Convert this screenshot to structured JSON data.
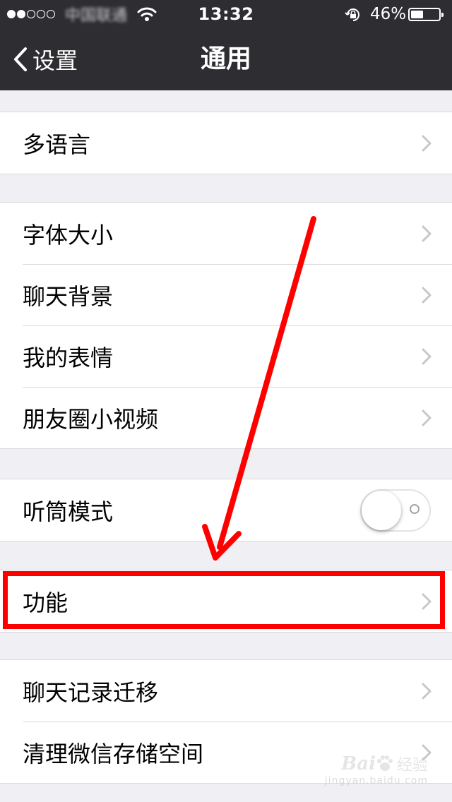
{
  "status_bar": {
    "carrier": "中国联通",
    "time": "13:32",
    "battery_percent": "46%",
    "battery_level": 0.46,
    "icons": [
      "signal-dots-icon",
      "wifi-icon",
      "rotation-lock-icon",
      "battery-icon"
    ]
  },
  "nav": {
    "back_label": "设置",
    "title": "通用"
  },
  "groups": [
    {
      "items": [
        {
          "label": "多语言",
          "accessory": "chevron"
        }
      ]
    },
    {
      "items": [
        {
          "label": "字体大小",
          "accessory": "chevron"
        },
        {
          "label": "聊天背景",
          "accessory": "chevron"
        },
        {
          "label": "我的表情",
          "accessory": "chevron"
        },
        {
          "label": "朋友圈小视频",
          "accessory": "chevron"
        }
      ]
    },
    {
      "items": [
        {
          "label": "听筒模式",
          "accessory": "toggle",
          "toggle_on": false
        }
      ]
    },
    {
      "items": [
        {
          "label": "功能",
          "accessory": "chevron",
          "highlighted": true
        }
      ]
    },
    {
      "items": [
        {
          "label": "聊天记录迁移",
          "accessory": "chevron"
        },
        {
          "label": "清理微信存储空间",
          "accessory": "chevron"
        }
      ]
    }
  ],
  "annotation": {
    "color": "#ff0000",
    "type": "arrow-and-box"
  },
  "watermark": {
    "brand": "Bai",
    "brand_cn": "经验",
    "url": "jingyan.baidu.com"
  },
  "colors": {
    "nav_background": "#2e2e32",
    "page_background": "#efeff4",
    "cell_background": "#ffffff",
    "chevron": "#c7c7cc"
  }
}
